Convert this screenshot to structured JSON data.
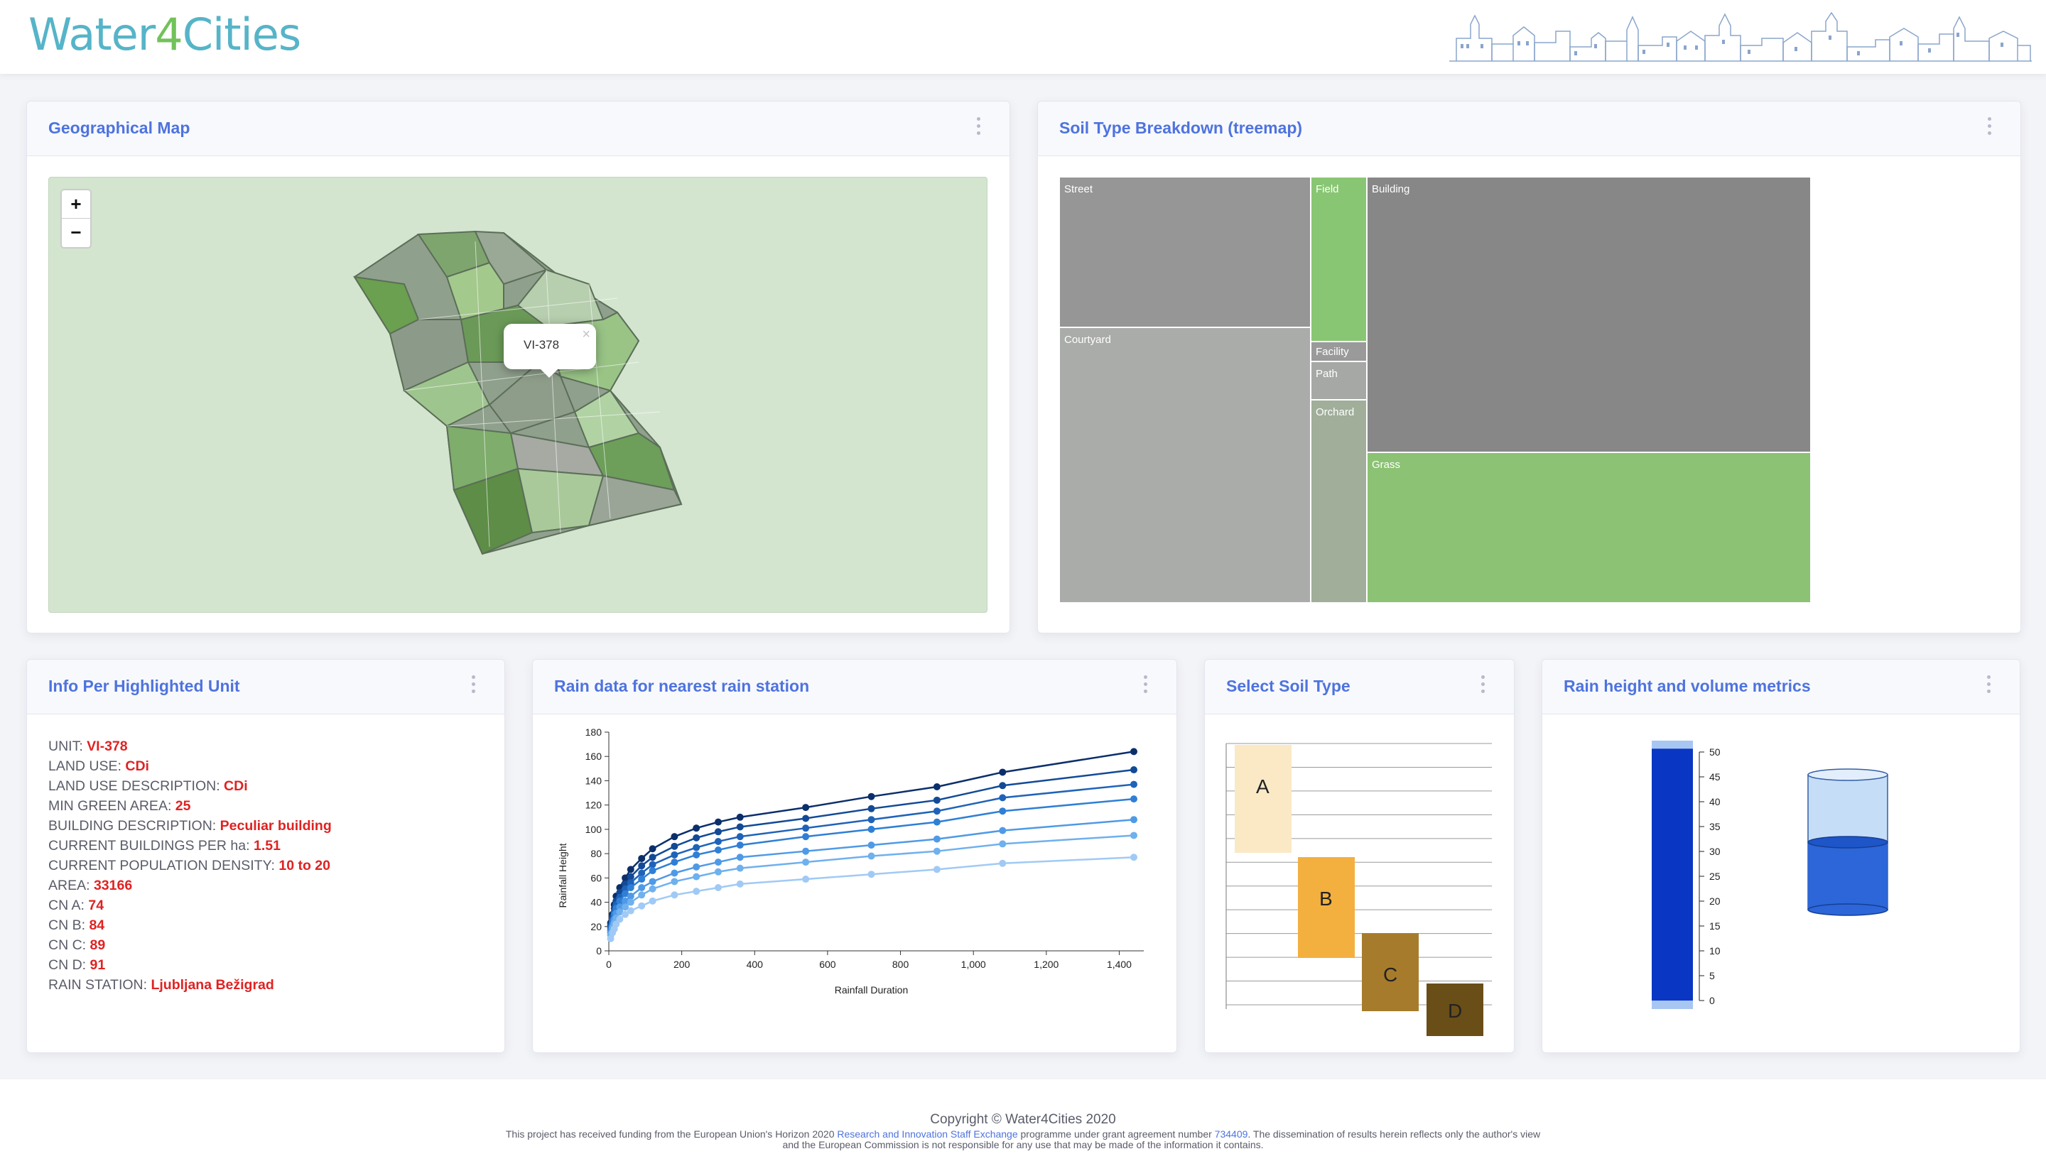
{
  "header": {
    "brand_part1": "Water",
    "brand_digit": "4",
    "brand_part2": "Cities"
  },
  "map_card": {
    "title": "Geographical Map",
    "zoom_in": "+",
    "zoom_out": "−",
    "popup_text": "VI-378",
    "popup_close": "×"
  },
  "treemap_card": {
    "title": "Soil Type Breakdown (treemap)",
    "cells": [
      {
        "label": "Street",
        "color": "#969696"
      },
      {
        "label": "Courtyard",
        "color": "#a9aca8"
      },
      {
        "label": "Field",
        "color": "#88c673"
      },
      {
        "label": "Facility",
        "color": "#9a9a9a"
      },
      {
        "label": "Path",
        "color": "#a6a8a5"
      },
      {
        "label": "Orchard",
        "color": "#a0ae9a"
      },
      {
        "label": "Building",
        "color": "#878787"
      },
      {
        "label": "Grass",
        "color": "#8bc273"
      }
    ]
  },
  "info_card": {
    "title": "Info Per Highlighted Unit",
    "rows": [
      {
        "label": "UNIT: ",
        "value": "VI-378"
      },
      {
        "label": "LAND USE: ",
        "value": "CDi"
      },
      {
        "label": "LAND USE DESCRIPTION: ",
        "value": "CDi"
      },
      {
        "label": "MIN GREEN AREA: ",
        "value": "25"
      },
      {
        "label": "BUILDING DESCRIPTION: ",
        "value": "Peculiar building"
      },
      {
        "label": "CURRENT BUILDINGS PER ha: ",
        "value": "1.51"
      },
      {
        "label": "CURRENT POPULATION DENSITY: ",
        "value": "10 to 20"
      },
      {
        "label": "AREA: ",
        "value": "33166"
      },
      {
        "label": "CN A: ",
        "value": "74"
      },
      {
        "label": "CN B: ",
        "value": "84"
      },
      {
        "label": "CN C: ",
        "value": "89"
      },
      {
        "label": "CN D: ",
        "value": "91"
      },
      {
        "label": "RAIN STATION: ",
        "value": "Ljubljana Bežigrad"
      }
    ]
  },
  "rain_card": {
    "title": "Rain data for nearest rain station"
  },
  "soil_card": {
    "title": "Select Soil Type",
    "types": [
      {
        "label": "A",
        "color": "#fbe9c6"
      },
      {
        "label": "B",
        "color": "#f3b03f"
      },
      {
        "label": "C",
        "color": "#a67c2c"
      },
      {
        "label": "D",
        "color": "#6a4e18"
      }
    ]
  },
  "metrics_card": {
    "title": "Rain height and volume metrics",
    "bar_color": "#0a36c4",
    "bar_level": 0.97,
    "cylinder_level": 0.5,
    "ticks": [
      "0",
      "5",
      "10",
      "15",
      "20",
      "25",
      "30",
      "35",
      "40",
      "45",
      "50"
    ]
  },
  "footer": {
    "copyright": "Copyright © Water4Cities 2020",
    "fund_pre": "This project has received funding from the European Union's Horizon 2020 ",
    "fund_link1": "Research and Innovation Staff Exchange",
    "fund_mid": " programme under grant agreement number ",
    "fund_link2": "734409",
    "fund_post": ". The dissemination of results herein reflects only the author's view",
    "fund_line2": "and the European Commission is not responsible for any use that may be made of the information it contains."
  },
  "chart_data": {
    "type": "line",
    "title": "",
    "xlabel": "Rainfall Duration",
    "ylabel": "Rainfall Height",
    "xlim": [
      0,
      1440
    ],
    "ylim": [
      0,
      180
    ],
    "xticks": [
      "0",
      "200",
      "400",
      "600",
      "800",
      "1,000",
      "1,200",
      "1,400"
    ],
    "yticks": [
      "0",
      "20",
      "40",
      "60",
      "80",
      "100",
      "120",
      "140",
      "160",
      "180"
    ],
    "x": [
      5,
      10,
      15,
      20,
      30,
      45,
      60,
      90,
      120,
      180,
      240,
      300,
      360,
      540,
      720,
      900,
      1080,
      1440
    ],
    "series": [
      {
        "color": "#0b2f6b",
        "values": [
          23,
          30,
          38,
          45,
          52,
          60,
          67,
          76,
          84,
          94,
          101,
          106,
          110,
          118,
          127,
          135,
          147,
          164
        ]
      },
      {
        "color": "#134a96",
        "values": [
          21,
          28,
          35,
          41,
          48,
          55,
          61,
          70,
          77,
          86,
          93,
          98,
          102,
          109,
          117,
          124,
          136,
          149
        ]
      },
      {
        "color": "#1f63b8",
        "values": [
          19,
          26,
          32,
          38,
          44,
          51,
          56,
          64,
          71,
          79,
          85,
          90,
          94,
          101,
          108,
          115,
          126,
          137
        ]
      },
      {
        "color": "#2f7fd6",
        "values": [
          17,
          24,
          30,
          35,
          41,
          47,
          52,
          59,
          66,
          73,
          79,
          83,
          87,
          94,
          100,
          106,
          115,
          125
        ]
      },
      {
        "color": "#4f9ae6",
        "values": [
          15,
          21,
          26,
          31,
          36,
          41,
          45,
          52,
          57,
          64,
          69,
          73,
          77,
          82,
          87,
          92,
          99,
          108
        ]
      },
      {
        "color": "#6fb0ee",
        "values": [
          13,
          19,
          23,
          27,
          32,
          36,
          40,
          46,
          51,
          57,
          61,
          65,
          68,
          73,
          78,
          82,
          88,
          95
        ]
      },
      {
        "color": "#a0caf5",
        "values": [
          10,
          15,
          18,
          22,
          26,
          30,
          33,
          37,
          41,
          46,
          49,
          52,
          55,
          59,
          63,
          67,
          72,
          77
        ]
      }
    ]
  }
}
